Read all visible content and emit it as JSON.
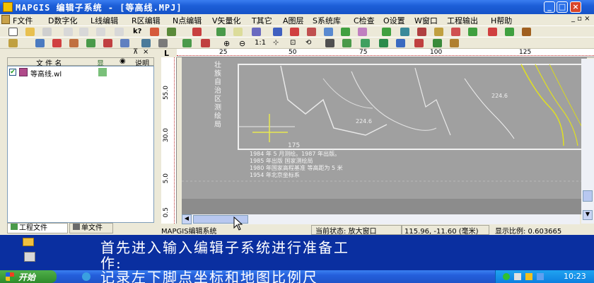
{
  "window": {
    "title": "MAPGIS 编辑子系统 - [等高线.MPJ]",
    "controls": [
      "_",
      "□",
      "×"
    ]
  },
  "menu": [
    "F文件",
    "D数字化",
    "L线编辑",
    "R区编辑",
    "N点编辑",
    "V矢量化",
    "T其它",
    "A图层",
    "S系统库",
    "C检查",
    "O设置",
    "W窗口",
    "工程输出",
    "H帮助"
  ],
  "toolbars": {
    "row1_zoom": "1:1",
    "accent": "#0a2fa0"
  },
  "left_panel": {
    "columns": [
      "文 件 名",
      "显",
      "说明"
    ],
    "files": [
      {
        "name": "等高线.wl",
        "checked": true
      }
    ],
    "tabs": [
      "工程文件",
      "单文件"
    ]
  },
  "ruler": {
    "top_ticks": [
      "25",
      "50",
      "75",
      "100",
      "125"
    ],
    "left_ticks": [
      "55.0",
      "30.0",
      "5.0",
      "0.5"
    ],
    "corner": "L"
  },
  "map_text": {
    "vertical_title": [
      "壮",
      "族",
      "自",
      "治",
      "区",
      "测",
      "绘",
      "局"
    ],
    "label_a": "224.6",
    "label_b": "224.6",
    "label_c": "175",
    "notes": [
      "1984 年 5 月测绘。1987 年出版。",
      "1985 年出版 国家测绘局",
      "1980 年国家高程基准 等高距为 5 米",
      "1954 年北京坐标系"
    ]
  },
  "status": {
    "left": "MAPGIS编辑系统",
    "state": "当前状态: 放大窗口",
    "coords": "115.96, -11.60 (毫米)",
    "scale": "显示比例: 0.603665"
  },
  "subtitle": {
    "line1": "首先进入输入编辑子系统进行准备工",
    "line2": "作:",
    "line3": "记录左下脚点坐标和地图比例尺"
  },
  "taskbar": {
    "start": "开始",
    "clock": "10:23"
  }
}
